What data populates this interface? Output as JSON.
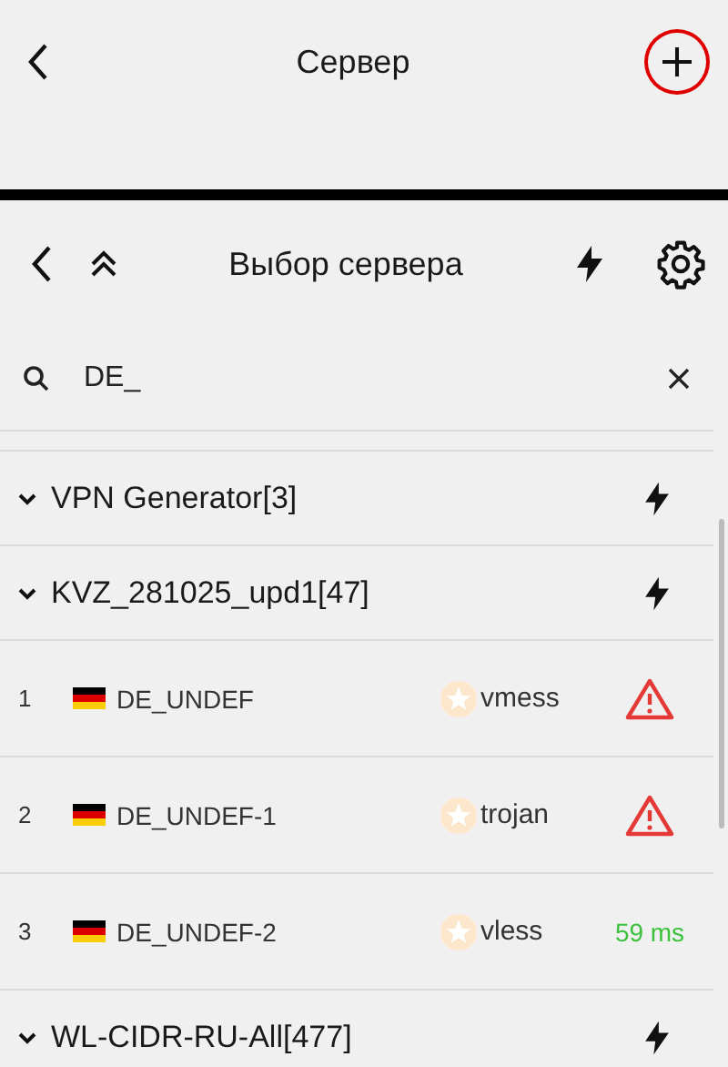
{
  "top_bar": {
    "title": "Сервер",
    "add_marked": true
  },
  "panel": {
    "title": "Выбор сервера"
  },
  "search": {
    "value": "DE_"
  },
  "groups": [
    {
      "name": "VPN Generator[3]",
      "expanded": true
    },
    {
      "name": "KVZ_281025_upd1[47]",
      "expanded": true,
      "servers": [
        {
          "index": "1",
          "name": "DE_UNDEF",
          "protocol": "vmess",
          "kind": "warning"
        },
        {
          "index": "2",
          "name": "DE_UNDEF-1",
          "protocol": "trojan",
          "kind": "warning"
        },
        {
          "index": "3",
          "name": "DE_UNDEF-2",
          "protocol": "vless",
          "kind": "latency",
          "latency": "59 ms"
        }
      ]
    },
    {
      "name": "WL-CIDR-RU-All[477]",
      "expanded": true
    }
  ]
}
